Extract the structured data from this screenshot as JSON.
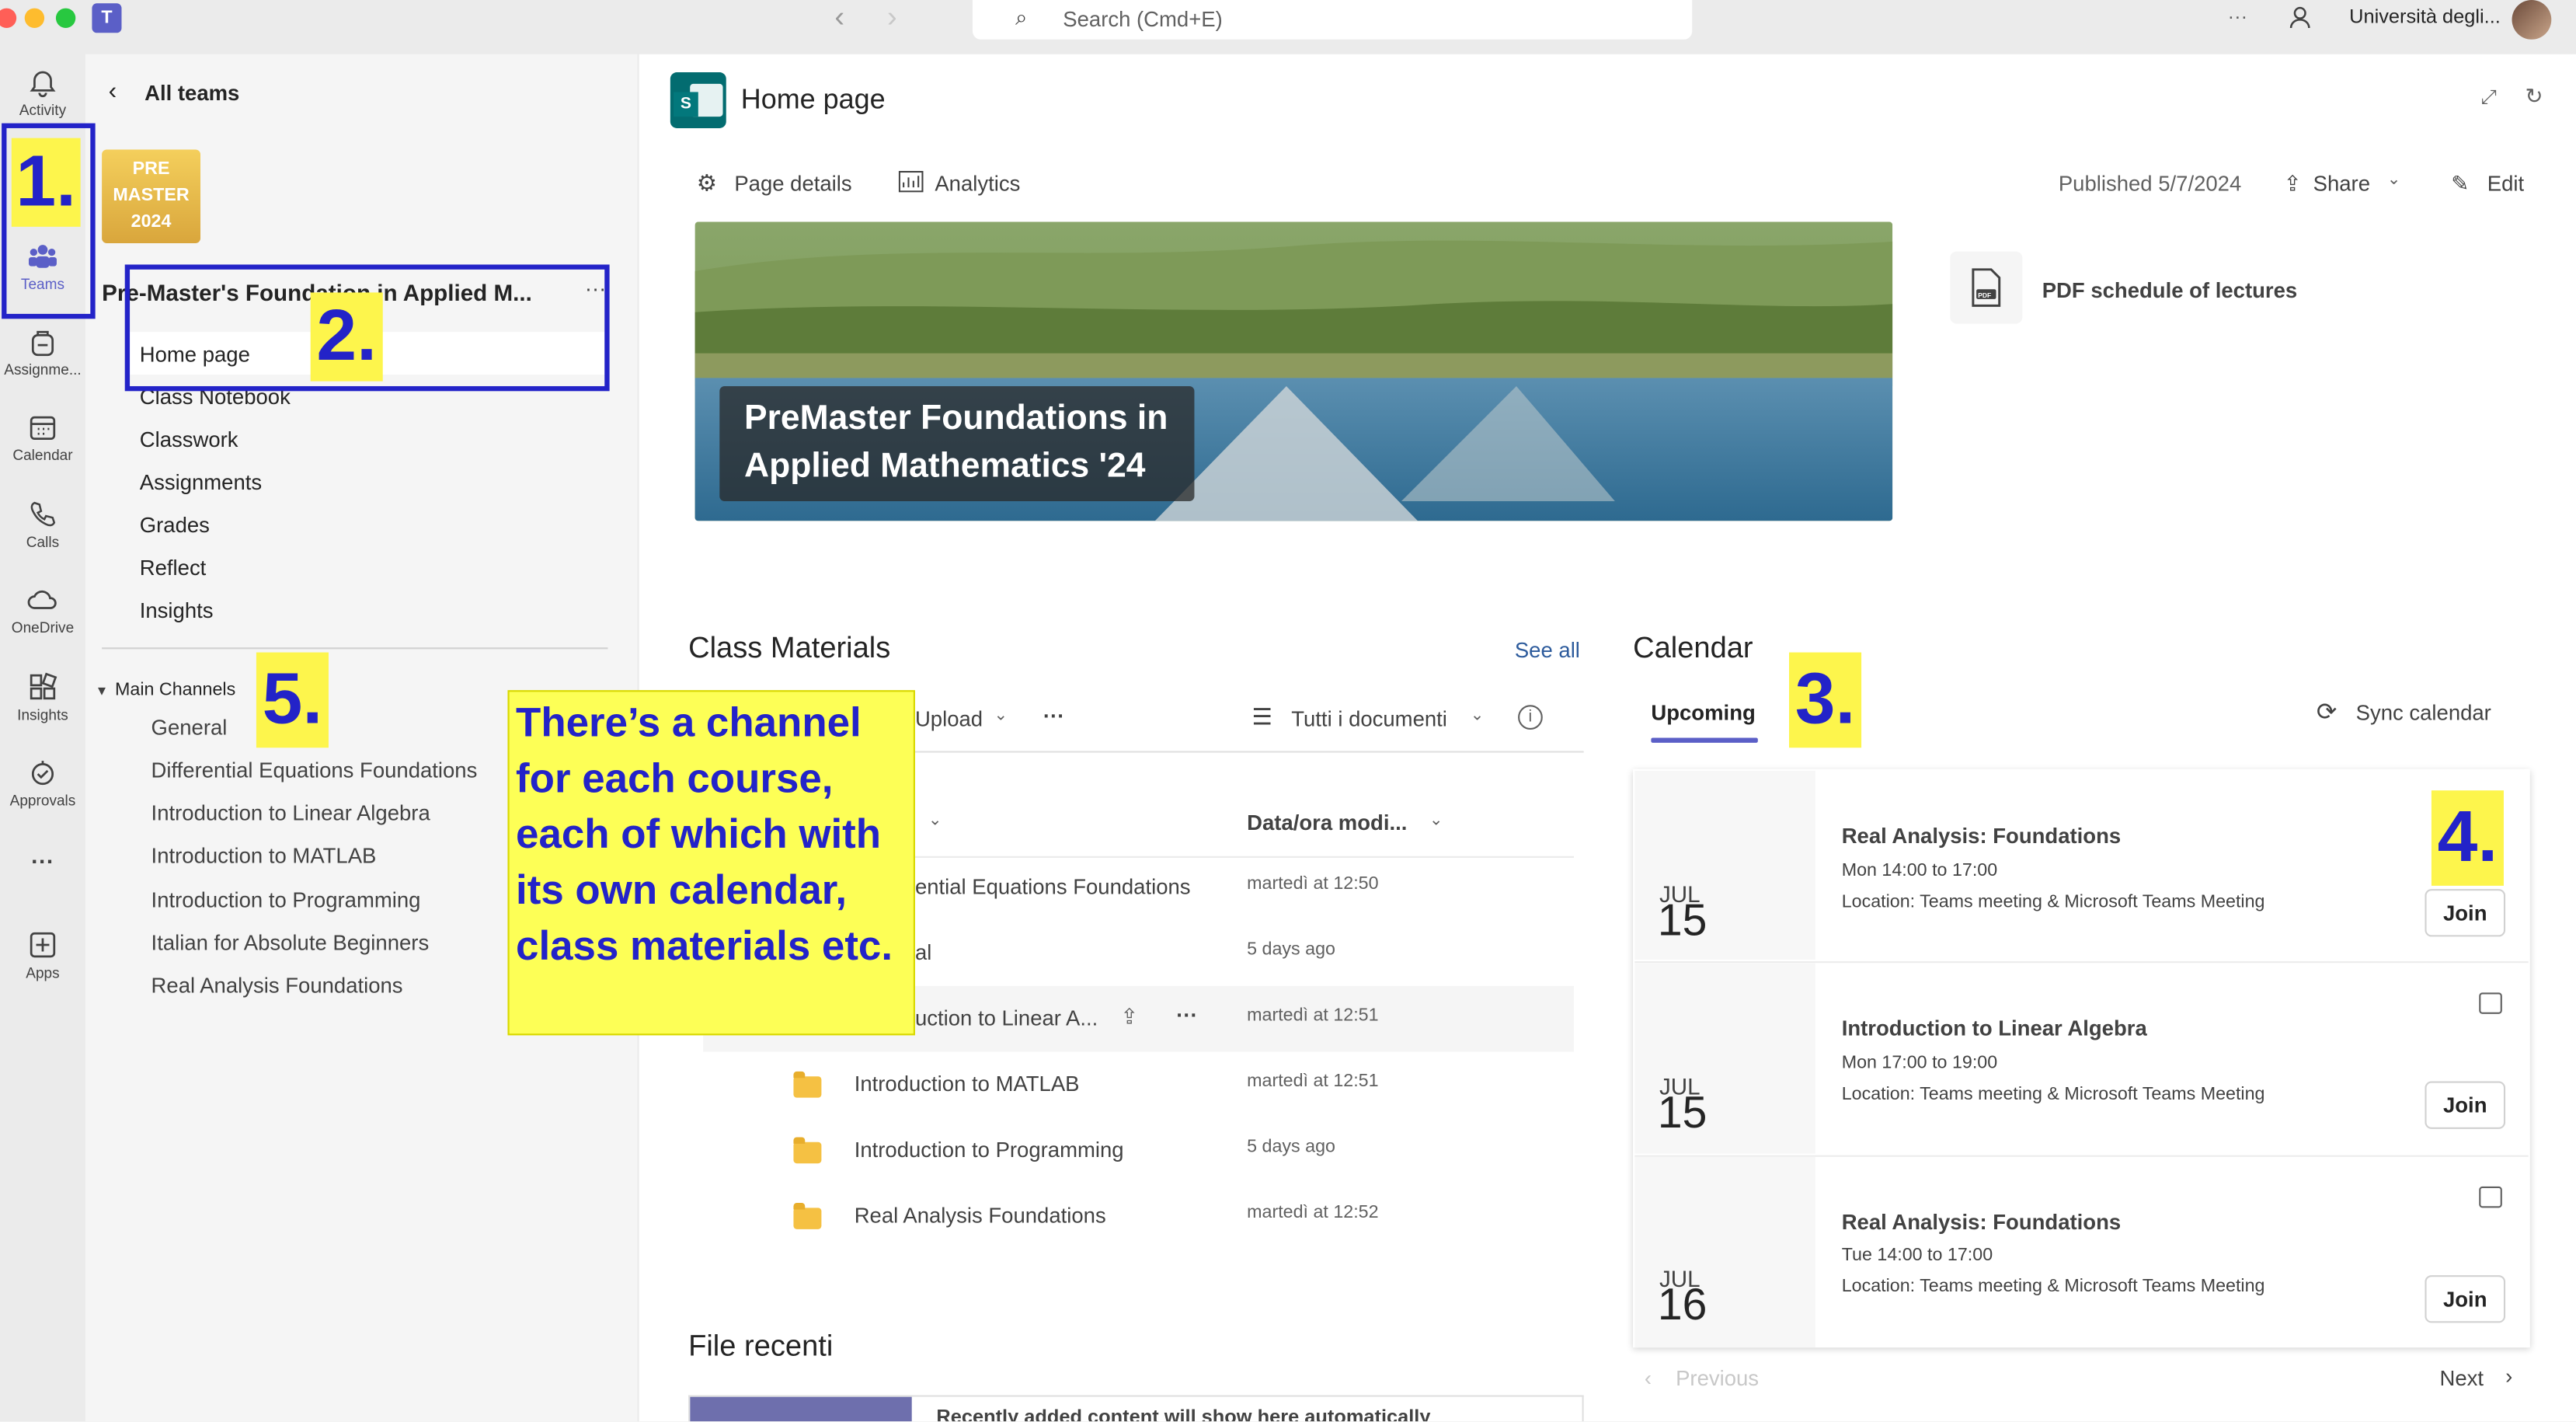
{
  "titlebar": {
    "search_placeholder": "Search (Cmd+E)",
    "org_name": "Università degli...",
    "more": "···"
  },
  "rail": [
    {
      "label": "Activity",
      "icon": "bell-icon"
    },
    {
      "label": "Teams",
      "icon": "teams-icon"
    },
    {
      "label": "Assignme...",
      "icon": "backpack-icon"
    },
    {
      "label": "Calendar",
      "icon": "calendar-icon"
    },
    {
      "label": "Calls",
      "icon": "phone-icon"
    },
    {
      "label": "OneDrive",
      "icon": "cloud-icon"
    },
    {
      "label": "Insights",
      "icon": "insights-icon"
    },
    {
      "label": "Approvals",
      "icon": "approvals-icon"
    },
    {
      "label": "···",
      "icon": "more-icon"
    },
    {
      "label": "Apps",
      "icon": "plus-box-icon"
    }
  ],
  "left_panel": {
    "back_label": "All teams",
    "team_tile_lines": [
      "PRE",
      "MASTER",
      "2024"
    ],
    "team_name": "Pre-Master's Foundation in Applied M...",
    "team_more": "···",
    "nav_items": [
      "Home page",
      "Class Notebook",
      "Classwork",
      "Assignments",
      "Grades",
      "Reflect",
      "Insights"
    ],
    "channels_header": "Main Channels",
    "channels": [
      "General",
      "Differential Equations Foundations",
      "Introduction to Linear Algebra",
      "Introduction to MATLAB",
      "Introduction to Programming",
      "Italian for Absolute Beginners",
      "Real Analysis Foundations"
    ]
  },
  "page": {
    "title": "Home page",
    "page_details": "Page details",
    "analytics": "Analytics",
    "published": "Published 5/7/2024",
    "share": "Share",
    "edit": "Edit",
    "hero_line1": "PreMaster Foundations in",
    "hero_line2": "Applied Mathematics '24",
    "pdf_link": "PDF schedule of lectures",
    "pdf_badge": "PDF"
  },
  "materials": {
    "title": "Class Materials",
    "see_all": "See all",
    "upload": "Upload",
    "more": "···",
    "view": "Tutti i documenti",
    "col_modified": "Data/ora modi...",
    "rows": [
      {
        "name": "ential Equations Foundations",
        "date": "martedì at 12:50"
      },
      {
        "name": "al",
        "date": "5 days ago"
      },
      {
        "name": "uction to Linear A...",
        "date": "martedì at 12:51"
      },
      {
        "name": "Introduction to MATLAB",
        "date": "martedì at 12:51"
      },
      {
        "name": "Introduction to Programming",
        "date": "5 days ago"
      },
      {
        "name": "Real Analysis Foundations",
        "date": "martedì at 12:52"
      }
    ]
  },
  "recent": {
    "title": "File recenti",
    "placeholder": "Recently added content will show here automatically"
  },
  "calendar": {
    "title": "Calendar",
    "tab": "Upcoming",
    "sync": "Sync calendar",
    "previous": "Previous",
    "next": "Next",
    "join": "Join",
    "events": [
      {
        "month": "JUL",
        "day": "15",
        "title": "Real Analysis: Foundations",
        "time": "Mon 14:00 to 17:00",
        "location": "Location: Teams meeting & Microsoft Teams Meeting"
      },
      {
        "month": "JUL",
        "day": "15",
        "title": "Introduction to Linear Algebra",
        "time": "Mon 17:00 to 19:00",
        "location": "Location: Teams meeting & Microsoft Teams Meeting"
      },
      {
        "month": "JUL",
        "day": "16",
        "title": "Real Analysis: Foundations",
        "time": "Tue 14:00 to 17:00",
        "location": "Location: Teams meeting & Microsoft Teams Meeting"
      }
    ]
  },
  "annotations": {
    "n1": "1.",
    "n2": "2.",
    "n3": "3.",
    "n4": "4.",
    "n5": "5.",
    "note_lines": [
      "There’s a channel",
      "for each course,",
      "each of which with",
      "its own calendar,",
      "class materials etc."
    ]
  },
  "colors": {
    "accent": "#5b5fc7",
    "annotation_blue": "#2323c8",
    "annotation_yellow": "#fdf54c"
  }
}
